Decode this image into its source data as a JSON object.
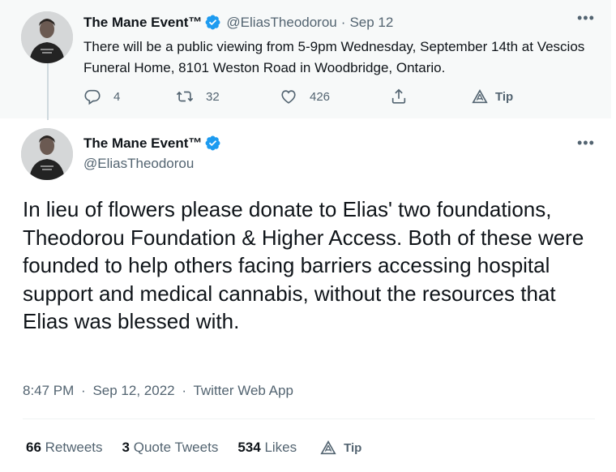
{
  "parent_tweet": {
    "author_name": "The Mane Event™",
    "handle": "@EliasTheodorou",
    "separator": "·",
    "date": "Sep 12",
    "text": "There will be a public viewing from 5-9pm Wednesday, September 14th at Vescios Funeral Home, 8101 Weston Road in Woodbridge, Ontario.",
    "more": "•••",
    "actions": {
      "replies": "4",
      "retweets": "32",
      "likes": "426",
      "tip_label": "Tip"
    }
  },
  "main_tweet": {
    "author_name": "The Mane Event™",
    "handle": "@EliasTheodorou",
    "more": "•••",
    "text": "In lieu of flowers please donate to Elias' two foundations, Theodorou Foundation & Higher Access. Both of these were founded to help others facing barriers accessing hospital support and medical cannabis, without the resources that Elias was blessed with.",
    "time": "8:47 PM",
    "separator": "·",
    "date": "Sep 12, 2022",
    "source": "Twitter Web App",
    "stats": {
      "retweets_count": "66",
      "retweets_label": "Retweets",
      "quotes_count": "3",
      "quotes_label": "Quote Tweets",
      "likes_count": "534",
      "likes_label": "Likes",
      "tip_label": "Tip"
    }
  },
  "colors": {
    "verified_blue": "#1d9bf0",
    "muted_text": "#536471",
    "primary_text": "#0f1419",
    "parent_background": "#f7f9f9"
  },
  "icons": [
    "avatar",
    "verified-badge-icon",
    "more-icon",
    "reply-icon",
    "retweet-icon",
    "like-icon",
    "share-icon",
    "tip-icon"
  ]
}
